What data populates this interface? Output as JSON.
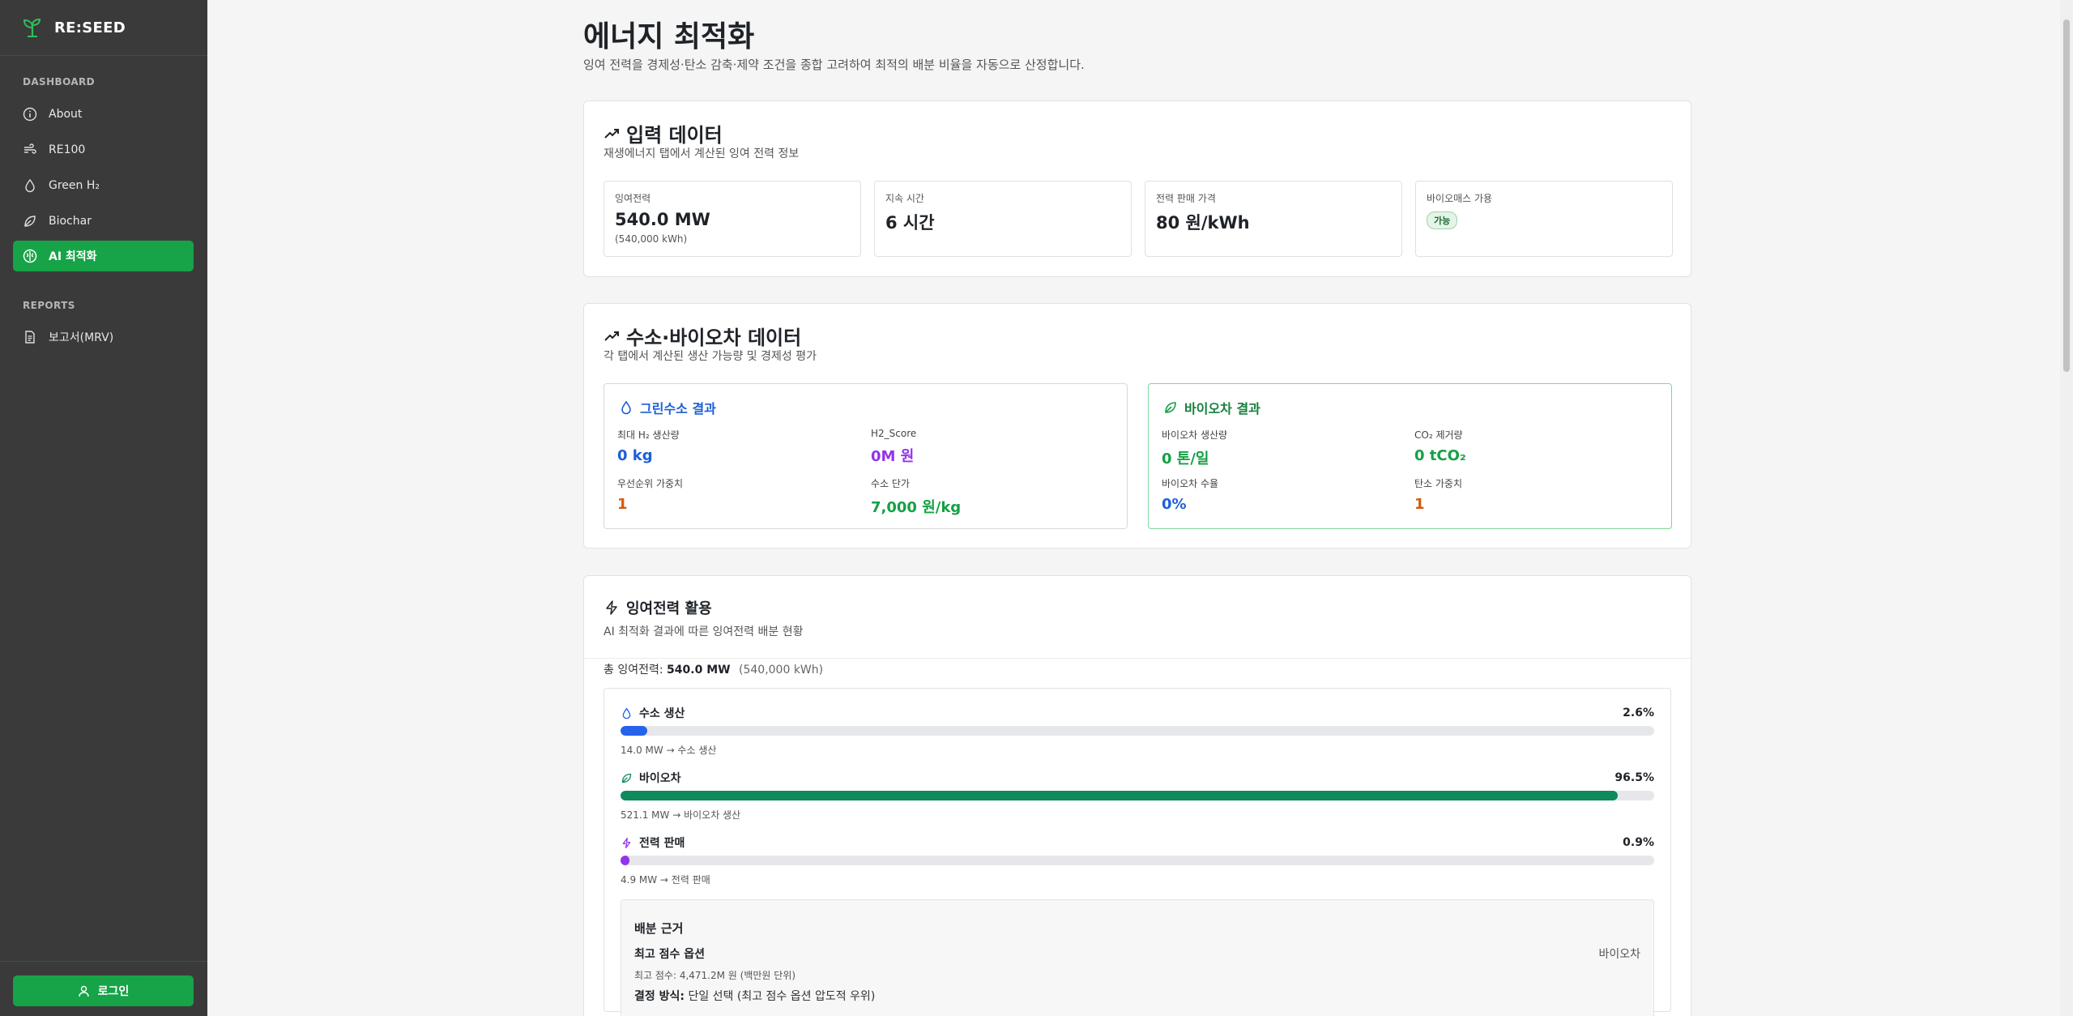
{
  "brand": {
    "name": "RE:SEED"
  },
  "sidebar": {
    "dashboard_label": "DASHBOARD",
    "reports_label": "REPORTS",
    "items": [
      {
        "label": "About",
        "icon": "info-icon"
      },
      {
        "label": "RE100",
        "icon": "wind-icon"
      },
      {
        "label": "Green H₂",
        "icon": "droplet-icon"
      },
      {
        "label": "Biochar",
        "icon": "leaf-icon"
      },
      {
        "label": "AI 최적화",
        "icon": "brain-icon",
        "active": true
      }
    ],
    "report_items": [
      {
        "label": "보고서(MRV)",
        "icon": "document-icon"
      }
    ],
    "login_label": "로그인"
  },
  "page": {
    "title": "에너지 최적화",
    "description": "잉여 전력을 경제성·탄소 감축·제약 조건을 종합 고려하여 최적의 배분 비율을 자동으로 산정합니다."
  },
  "input_card": {
    "title": "입력 데이터",
    "subtitle": "재생에너지 탭에서 계산된 잉여 전력 정보",
    "stats": [
      {
        "label": "잉여전력",
        "value": "540.0 MW",
        "note": "(540,000 kWh)"
      },
      {
        "label": "지속 시간",
        "value": "6 시간"
      },
      {
        "label": "전력 판매 가격",
        "value": "80 원/kWh"
      },
      {
        "label": "바이오매스 가용",
        "badge": "가능"
      }
    ]
  },
  "h2bio_card": {
    "title": "수소·바이오차 데이터",
    "subtitle": "각 탭에서 계산된 생산 가능량 및 경제성 평가",
    "h2": {
      "title": "그린수소 결과",
      "metrics": [
        {
          "label": "최대 H₂ 생산량",
          "value": "0 kg"
        },
        {
          "label": "H2_Score",
          "value": "0M 원"
        },
        {
          "label": "우선순위 가중치",
          "value": "1"
        },
        {
          "label": "수소 단가",
          "value": "7,000 원/kg"
        }
      ]
    },
    "bio": {
      "title": "바이오차 결과",
      "metrics": [
        {
          "label": "바이오차 생산량",
          "value": "0 톤/일"
        },
        {
          "label": "CO₂ 제거량",
          "value": "0 tCO₂"
        },
        {
          "label": "바이오차 수율",
          "value": "0%"
        },
        {
          "label": "탄소 가중치",
          "value": "1"
        }
      ]
    },
    "colors": {
      "blue": "#1d5fd6",
      "purple": "#9333ea",
      "orange": "#d45a10",
      "green": "#15a045"
    }
  },
  "util_card": {
    "title": "잉여전력 활용",
    "subtitle": "AI 최적화 결과에 따른 잉여전력 배분 현황",
    "total_label": "총 잉여전력:",
    "total_value": "540.0 MW",
    "total_kwh": "(540,000 kWh)",
    "allocations": [
      {
        "name": "수소 생산",
        "pct_label": "2.6%",
        "fraction": 0.026,
        "note": "14.0 MW → 수소 생산",
        "color": "#2563eb",
        "icon": "droplet-icon"
      },
      {
        "name": "바이오차",
        "pct_label": "96.5%",
        "fraction": 0.965,
        "note": "521.1 MW → 바이오차 생산",
        "color": "#0f8a5a",
        "icon": "leaf-icon"
      },
      {
        "name": "전력 판매",
        "pct_label": "0.9%",
        "fraction": 0.009,
        "note": "4.9 MW → 전력 판매",
        "color": "#9333ea",
        "icon": "bolt-icon"
      }
    ],
    "basis": {
      "title": "배분 근거",
      "best_label": "최고 점수 옵션",
      "best_value": "바이오차",
      "score": "최고 점수: 4,471.2M 원 (백만원 단위)",
      "method_label": "결정 방식:",
      "method_value": "단일 선택 (최고 점수 옵션 압도적 우위)"
    }
  }
}
